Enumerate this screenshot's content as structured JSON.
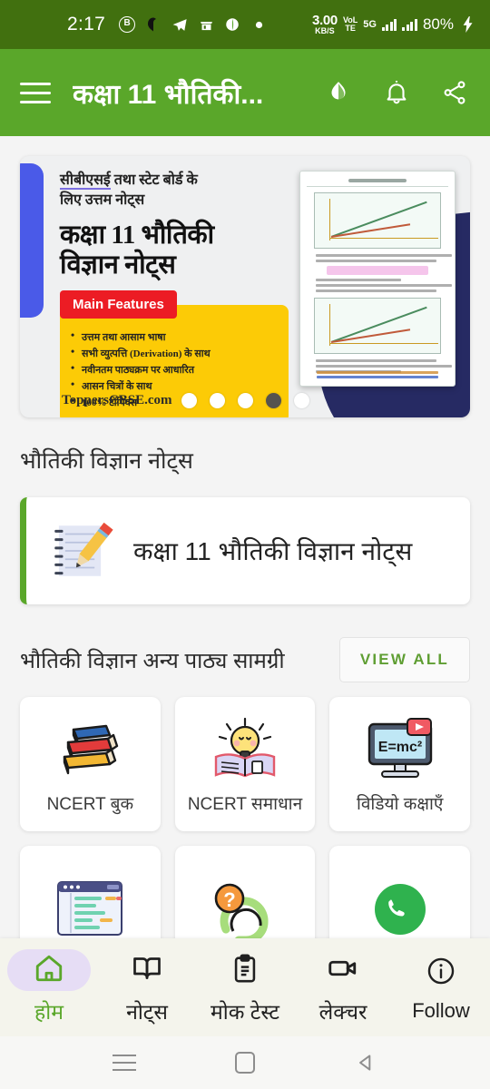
{
  "status_bar": {
    "time": "2:17",
    "icons": [
      "b-circle-icon",
      "mail-icon",
      "telegram-icon",
      "store-icon",
      "globe-icon",
      "dot-icon"
    ],
    "data_rate": "3.00",
    "data_rate_unit": "KB/S",
    "volte": "VoLTE",
    "network": "5G",
    "battery": "80%",
    "charging": true,
    "bg_color": "#41700f"
  },
  "app_bar": {
    "title": "कक्षा 11 भौतिकी...",
    "menu_icon": "hamburger-icon",
    "actions": [
      "theme-drop-icon",
      "notification-bell-icon",
      "share-icon"
    ],
    "bg_color": "#5aa72a"
  },
  "banner": {
    "subtitle_part1": "सीबीएसई",
    "subtitle_part2": " तथा स्टेट बोर्ड के",
    "subtitle_line2": "लिए उत्तम नोट्स",
    "title_line1": "कक्षा 11 भौतिकी",
    "title_line2": "विज्ञान नोट्स",
    "features_badge": "Main Features",
    "features": [
      "उत्तम तथा आसाम भाषा",
      "सभी व्युत्पत्ति (Derivation) के साथ",
      "नवीनतम पाठ्यक्रम पर आधारित",
      "आसन चित्रों के साथ",
      "100% टॉपिक्स"
    ],
    "brand": "ToppersCBSE.com",
    "accent_blue": "#4a5ae8",
    "accent_yellow": "#fccb06",
    "accent_red": "#ec1c24",
    "accent_navy": "#262a63",
    "dots_count": 5,
    "active_dot_index": 3
  },
  "notes_section": {
    "heading": "भौतिकी विज्ञान नोट्स",
    "card_label": "कक्षा 11 भौतिकी विज्ञान नोट्स",
    "card_icon": "notepad-pencil-icon",
    "accent_color": "#5aa72a"
  },
  "material_section": {
    "heading": "भौतिकी विज्ञान अन्य पाठ्य सामग्री",
    "view_all_label": "VIEW ALL",
    "view_all_color": "#5f9e33",
    "cards": [
      {
        "label": "NCERT बुक",
        "icon": "books-stack-icon"
      },
      {
        "label": "NCERT समाधान",
        "icon": "lightbulb-book-icon"
      },
      {
        "label": "विडियो कक्षाएँ",
        "icon": "monitor-emc2-icon"
      },
      {
        "label": "",
        "icon": "dashboard-window-icon"
      },
      {
        "label": "",
        "icon": "question-mark-icon"
      },
      {
        "label": "",
        "icon": "whatsapp-icon"
      }
    ]
  },
  "bottom_nav": {
    "items": [
      {
        "label": "होम",
        "icon": "home-icon",
        "active": true
      },
      {
        "label": "नोट्स",
        "icon": "open-book-icon",
        "active": false
      },
      {
        "label": "मोक टेस्ट",
        "icon": "clipboard-icon",
        "active": false
      },
      {
        "label": "लेक्चर",
        "icon": "video-camera-icon",
        "active": false
      },
      {
        "label": "Follow",
        "icon": "info-circle-icon",
        "active": false
      }
    ],
    "bg_color": "#f4f4ec",
    "active_pill_color": "#e6ddf5",
    "active_color": "#5aa72a"
  },
  "system_nav": {
    "buttons": [
      "recent-apps-icon",
      "home-square-icon",
      "back-triangle-icon"
    ]
  }
}
